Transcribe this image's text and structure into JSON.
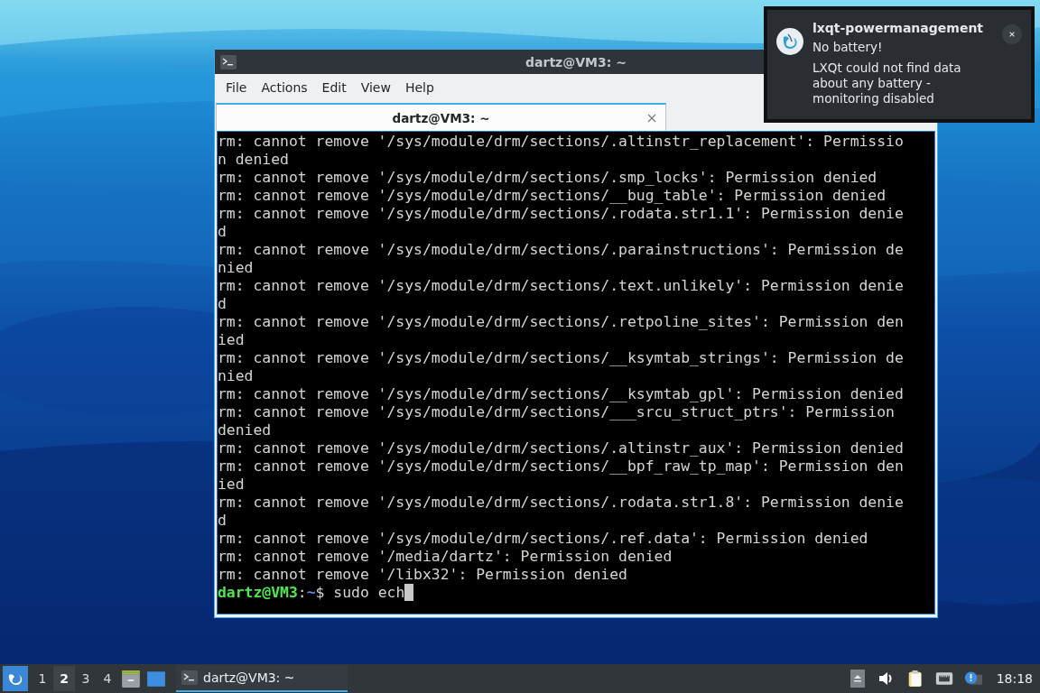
{
  "window": {
    "title": "dartz@VM3: ~",
    "menu": [
      "File",
      "Actions",
      "Edit",
      "View",
      "Help"
    ],
    "tabs": [
      {
        "label": "dartz@VM3: ~",
        "selected": true
      }
    ],
    "terminal": {
      "lines": [
        "rm: cannot remove '/sys/module/drm/sections/.altinstr_replacement': Permissio",
        "n denied",
        "rm: cannot remove '/sys/module/drm/sections/.smp_locks': Permission denied",
        "rm: cannot remove '/sys/module/drm/sections/__bug_table': Permission denied",
        "rm: cannot remove '/sys/module/drm/sections/.rodata.str1.1': Permission denie",
        "d",
        "rm: cannot remove '/sys/module/drm/sections/.parainstructions': Permission de",
        "nied",
        "rm: cannot remove '/sys/module/drm/sections/.text.unlikely': Permission denie",
        "d",
        "rm: cannot remove '/sys/module/drm/sections/.retpoline_sites': Permission den",
        "ied",
        "rm: cannot remove '/sys/module/drm/sections/__ksymtab_strings': Permission de",
        "nied",
        "rm: cannot remove '/sys/module/drm/sections/__ksymtab_gpl': Permission denied",
        "rm: cannot remove '/sys/module/drm/sections/___srcu_struct_ptrs': Permission",
        "denied",
        "rm: cannot remove '/sys/module/drm/sections/.altinstr_aux': Permission denied",
        "rm: cannot remove '/sys/module/drm/sections/__bpf_raw_tp_map': Permission den",
        "ied",
        "rm: cannot remove '/sys/module/drm/sections/.rodata.str1.8': Permission denie",
        "d",
        "rm: cannot remove '/sys/module/drm/sections/.ref.data': Permission denied",
        "rm: cannot remove '/media/dartz': Permission denied",
        "rm: cannot remove '/libx32': Permission denied"
      ],
      "prompt": {
        "user_host": "dartz@VM3",
        "separator": ":",
        "path": "~",
        "symbol": "$",
        "command": "sudo ech"
      }
    }
  },
  "notification": {
    "app": "lxqt-powermanagement",
    "summary": "No battery!",
    "body": "LXQt could not find data about any battery - monitoring disabled"
  },
  "taskbar": {
    "desktops": [
      {
        "label": "1",
        "selected": false
      },
      {
        "label": "2",
        "selected": true
      },
      {
        "label": "3",
        "selected": false
      },
      {
        "label": "4",
        "selected": false
      }
    ],
    "tasks": [
      {
        "label": "dartz@VM3: ~",
        "active": true
      }
    ],
    "clock": "18:18"
  }
}
